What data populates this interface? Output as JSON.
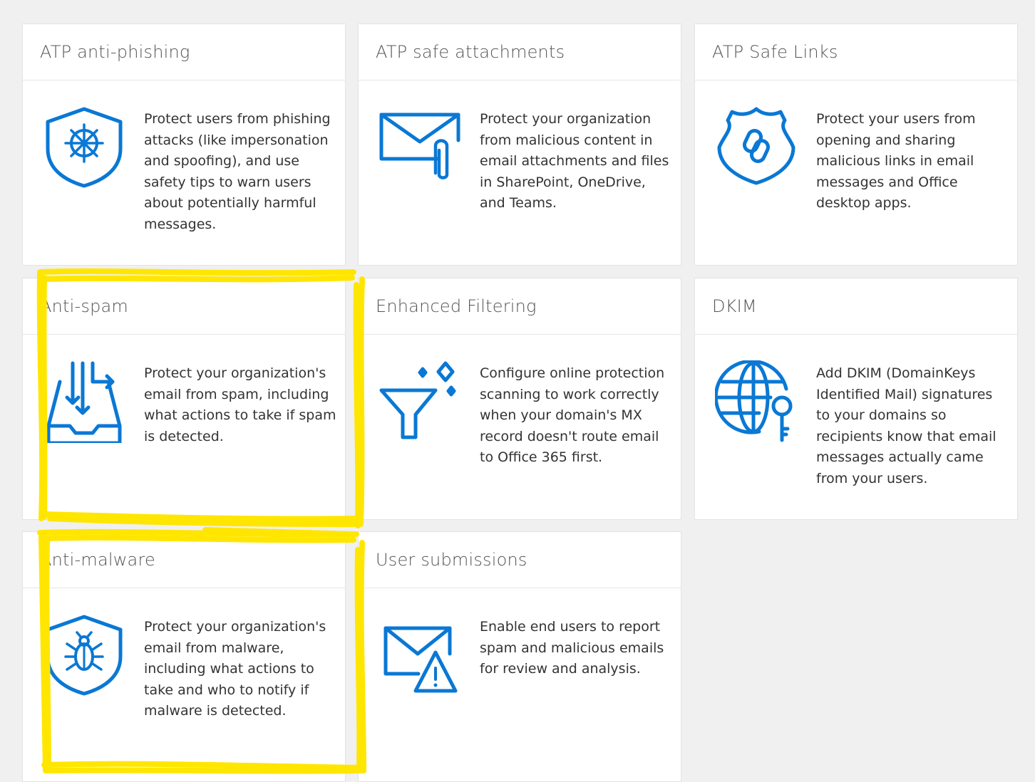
{
  "accent_color": "#0a78d4",
  "highlight_color": "#ffe600",
  "cards": [
    {
      "title": "ATP anti-phishing",
      "description": "Protect users from phishing attacks (like impersonation and spoofing), and use safety tips to warn users about potentially harmful messages.",
      "icon": "shield-wheel-icon",
      "highlighted": false
    },
    {
      "title": "ATP safe attachments",
      "description": "Protect your organization from malicious content in email attachments and files in SharePoint, OneDrive, and Teams.",
      "icon": "envelope-paperclip-icon",
      "highlighted": false
    },
    {
      "title": "ATP Safe Links",
      "description": "Protect your users from opening and sharing malicious links in email messages and Office desktop apps.",
      "icon": "badge-link-icon",
      "highlighted": false
    },
    {
      "title": "Anti-spam",
      "description": "Protect your organization's email from spam, including what actions to take if spam is detected.",
      "icon": "inbox-tray-arrows-icon",
      "highlighted": true
    },
    {
      "title": "Enhanced Filtering",
      "description": "Configure online protection scanning to work correctly when your domain's MX record doesn't route email to Office 365 first.",
      "icon": "funnel-sparkle-icon",
      "highlighted": false
    },
    {
      "title": "DKIM",
      "description": "Add DKIM (DomainKeys Identified Mail) signatures to your domains so recipients know that email messages actually came from your users.",
      "icon": "globe-key-icon",
      "highlighted": false
    },
    {
      "title": "Anti-malware",
      "description": "Protect your organization's email from malware, including what actions to take and who to notify if malware is detected.",
      "icon": "shield-bug-icon",
      "highlighted": true
    },
    {
      "title": "User submissions",
      "description": "Enable end users to report spam and malicious emails for review and analysis.",
      "icon": "envelope-warning-icon",
      "highlighted": false
    }
  ]
}
